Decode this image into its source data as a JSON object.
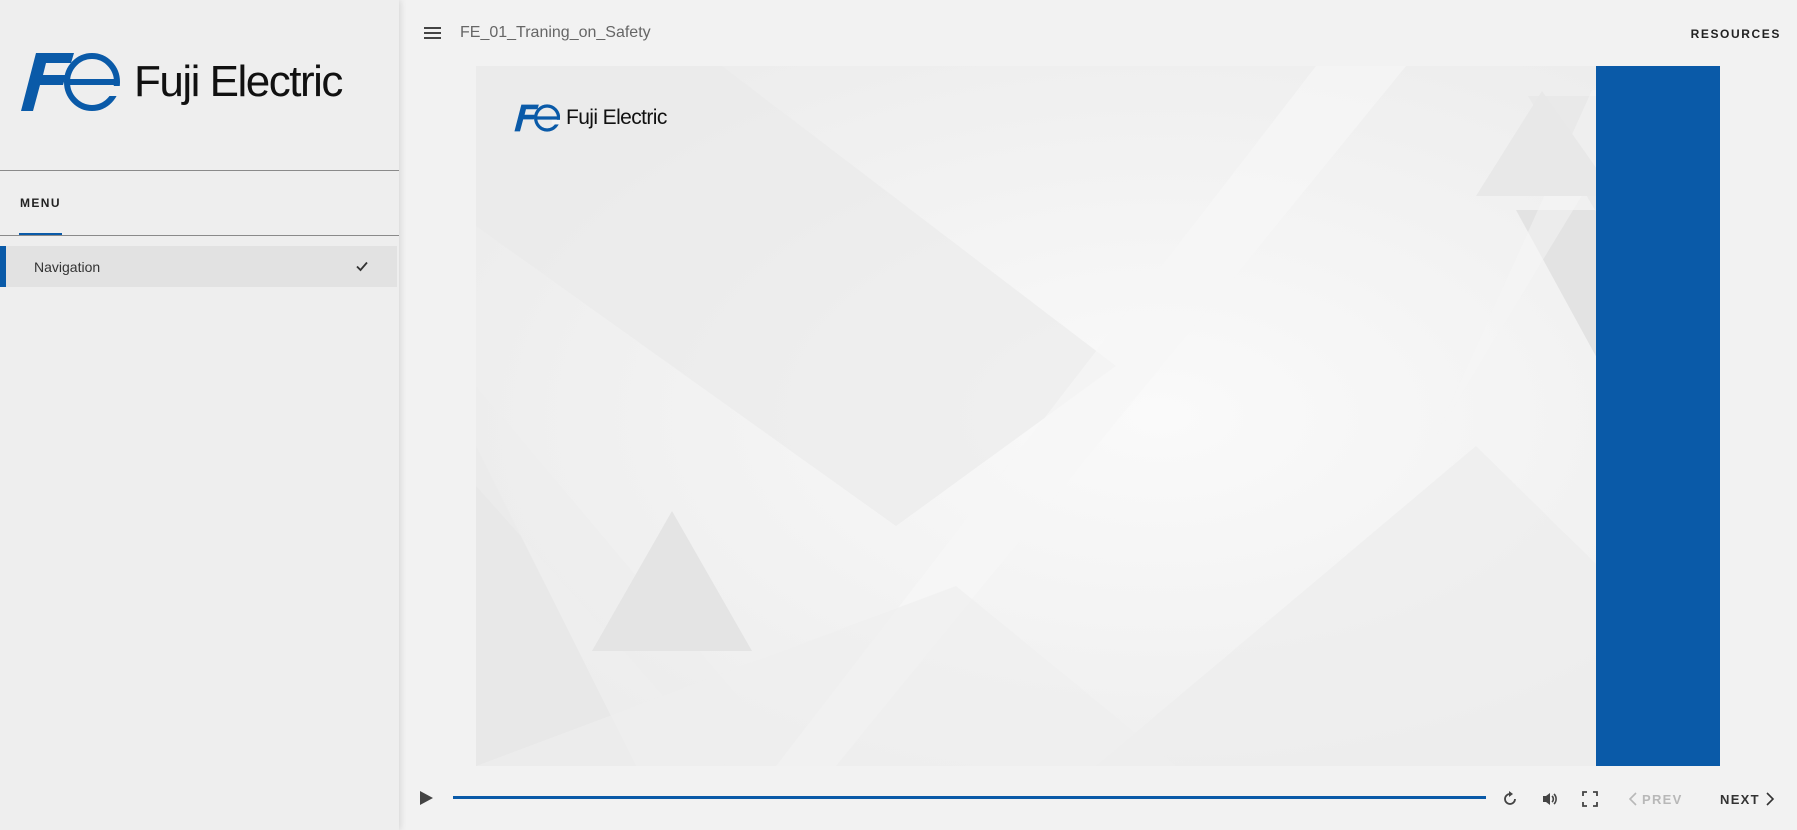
{
  "app": {
    "course_title": "FE_01_Traning_on_Safety",
    "resources_label": "RESOURCES"
  },
  "brand": {
    "logo_text": "Fuji Electric",
    "color": "#0a5aa8"
  },
  "sidebar": {
    "menu_tab_label": "MENU",
    "items": [
      {
        "label": "Navigation",
        "completed": true,
        "selected": true
      }
    ]
  },
  "slide": {
    "logo_text": "Fuji Electric"
  },
  "player": {
    "prev_label": "PREV",
    "next_label": "NEXT",
    "prev_enabled": false,
    "icons": [
      "play-icon",
      "replay-icon",
      "volume-icon",
      "fullscreen-icon"
    ]
  }
}
